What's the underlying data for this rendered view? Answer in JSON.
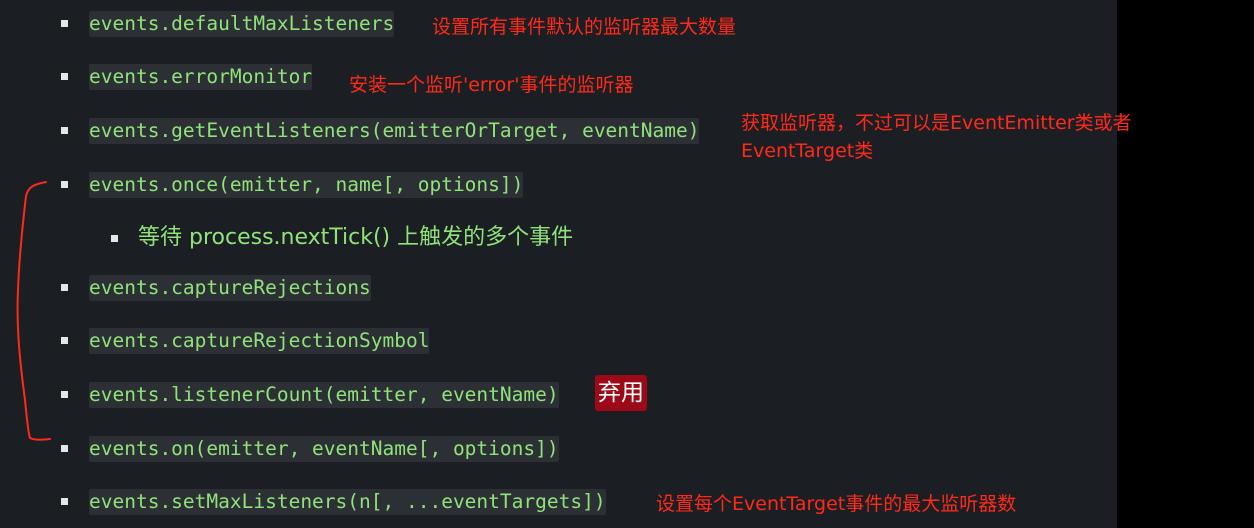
{
  "items": [
    {
      "code": "events.defaultMaxListeners",
      "note": "设置所有事件默认的监听器最大数量"
    },
    {
      "code": "events.errorMonitor",
      "note": "安装一个监听'error'事件的监听器"
    },
    {
      "code": "events.getEventListeners(emitterOrTarget, eventName)",
      "note_line1": "获取监听器，不过可以是EventEmitter类或者",
      "note_line2": "EventTarget类"
    },
    {
      "code": "events.once(emitter, name[, options])"
    },
    {
      "sub": "等待 process.nextTick() 上触发的多个事件"
    },
    {
      "code": "events.captureRejections"
    },
    {
      "code": "events.captureRejectionSymbol"
    },
    {
      "code": "events.listenerCount(emitter, eventName)",
      "badge": "弃用"
    },
    {
      "code": "events.on(emitter, eventName[, options])"
    },
    {
      "code": "events.setMaxListeners(n[, ...eventTargets])",
      "note": "设置每个EventTarget事件的最大监听器数"
    }
  ],
  "colors": {
    "background": "#1b1e22",
    "code_bg": "#2c3034",
    "code_text": "#8fe37a",
    "annotation": "#ff2a1a",
    "badge_bg": "#9c0a18"
  }
}
